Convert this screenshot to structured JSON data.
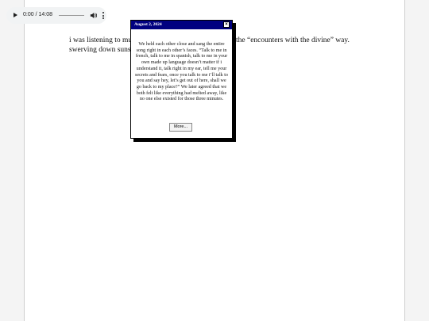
{
  "audio_player": {
    "time": "0:00 / 14:08",
    "icons": [
      "play-icon",
      "volume-icon",
      "more-vert-icon"
    ]
  },
  "post": {
    "line1_start": "i was listening to mu",
    "line1_end": "the “encounters with the divine” way.",
    "line2": "swerving down suns"
  },
  "popup": {
    "title": "August 2, 2024",
    "close_label": "×",
    "body": "We held each other close and sang the entire song right in each other’s faces. “Talk to me in french, talk to me in spanish, talk to me in your own made up language doesn’t matter if i understand it, talk right in my ear, tell me your secrets and fears, once you talk to me i’ll talk to you and say hey, let’s get out of here, shall we go back to my place?” We later agreed that we both felt like everything had melted away, like no one else existed for those three minutes.",
    "more_label": "More..."
  }
}
